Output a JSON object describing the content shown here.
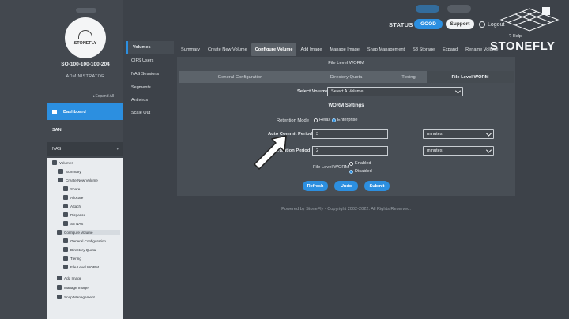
{
  "header": {
    "status_label": "STATUS :",
    "status_value": "GOOD",
    "support_label": "Support",
    "logout_label": "Logout",
    "help_label": "Help",
    "brand": "STONEFLY"
  },
  "sidebar": {
    "logo_text": "STONEFLY",
    "hostname": "SO-100-100-100-204",
    "role": "ADMINISTRATOR",
    "expand_all": "Expand All",
    "dashboard": "Dashboard",
    "san": "SAN",
    "nas": "NAS",
    "tree": [
      {
        "label": "Volumes"
      },
      {
        "label": "Summary"
      },
      {
        "label": "Create New Volume"
      },
      {
        "label": "Share"
      },
      {
        "label": "Allocate"
      },
      {
        "label": "Attach"
      },
      {
        "label": "Dispense"
      },
      {
        "label": "S3 NAS"
      },
      {
        "label": "Configure Volume"
      },
      {
        "label": "General Configuration"
      },
      {
        "label": "Directory Quota"
      },
      {
        "label": "Tiering"
      },
      {
        "label": "File Level WORM"
      },
      {
        "label": "Add Image"
      },
      {
        "label": "Manage Image"
      },
      {
        "label": "Snap Management"
      }
    ]
  },
  "subnav": {
    "items": [
      {
        "label": "Volumes"
      },
      {
        "label": "CIFS Users"
      },
      {
        "label": "NAS Sessions"
      },
      {
        "label": "Segments"
      },
      {
        "label": "Antivirus"
      },
      {
        "label": "Scale Out"
      }
    ]
  },
  "tabs": [
    {
      "label": "Summary"
    },
    {
      "label": "Create New Volume"
    },
    {
      "label": "Configure Volume"
    },
    {
      "label": "Add Image"
    },
    {
      "label": "Manage Image"
    },
    {
      "label": "Snap Management"
    },
    {
      "label": "S3 Storage"
    },
    {
      "label": "Expand"
    },
    {
      "label": "Rename Volume"
    }
  ],
  "panel": {
    "header": "File Level WORM",
    "subtabs": [
      {
        "label": "General Configuration"
      },
      {
        "label": "Directory Quota"
      },
      {
        "label": "Tiering"
      },
      {
        "label": "File Level WORM"
      }
    ],
    "select_volume_label": "Select Volume",
    "select_volume_value": "Select A Volume",
    "worm_settings": "WORM Settings",
    "retention_mode_label": "Retention Mode",
    "retention_modes": [
      "Relax",
      "Enterprise"
    ],
    "auto_commit_label": "Auto Commit Period",
    "auto_commit_value": "3",
    "auto_commit_unit": "minutes",
    "retention_period_label": "Retention Period",
    "retention_period_value": "2",
    "retention_period_unit": "minutes",
    "file_level_worm_label": "File Level WORM",
    "worm_options": [
      "Enabled",
      "Disabled"
    ],
    "buttons": {
      "refresh": "Refresh",
      "undo": "Undo",
      "submit": "Submit"
    }
  },
  "footer": "Powered by StoneFly - Copyright 2002-2022. All Rights Reserved.",
  "colors": {
    "accent": "#2c8fe0",
    "background": "#3d4249",
    "panel": "#484e55"
  }
}
